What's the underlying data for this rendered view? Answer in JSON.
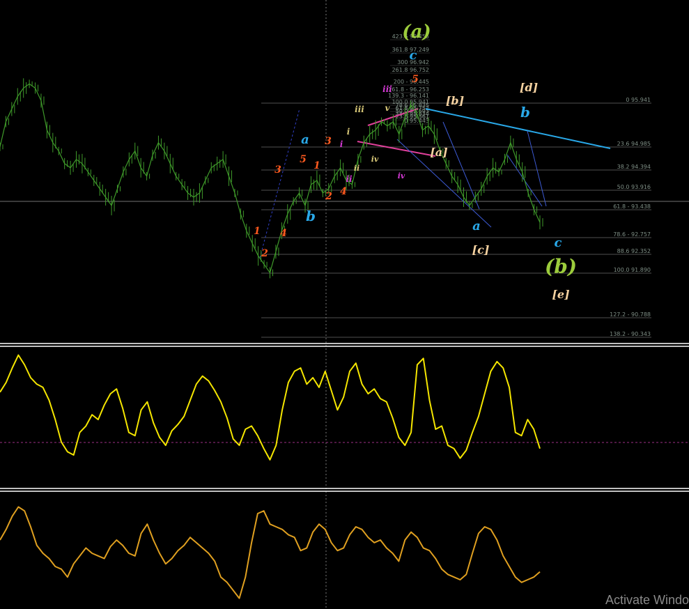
{
  "colors": {
    "background": "#000000",
    "price_line": "#3f9a2a",
    "oscillator_1": "#f5e600",
    "oscillator_2": "#e0a020",
    "fib_line": "#6a6a6a",
    "trend_blue": "#29a8e8",
    "trend_pink": "#e0409a",
    "separator": "#ffffff",
    "zero_line": "#9b2f86"
  },
  "fib_levels": [
    {
      "label": "0 95.941",
      "price": 95.941
    },
    {
      "label": "23.6 94.985",
      "price": 94.985
    },
    {
      "label": "38.2 94.394",
      "price": 94.394
    },
    {
      "label": "50.0 93.916",
      "price": 93.916
    },
    {
      "label": "61.8 - 93.438",
      "price": 93.438
    },
    {
      "label": "78.6 - 92.757",
      "price": 92.757
    },
    {
      "label": "88.6 92.352",
      "price": 92.352
    },
    {
      "label": "100.0 91.890",
      "price": 91.89
    },
    {
      "label": "127.2 - 90.788",
      "price": 90.788
    },
    {
      "label": "138.2 - 90.343",
      "price": 90.343
    }
  ],
  "fib_stack": [
    "423.6 98.455",
    "361.8 97.249",
    "300 96.942",
    "261.8 96.752",
    "200 - 96.445",
    "161.8 - 96.253",
    "139.3 - 96.141",
    "100.0 95.941",
    "78.6 95.835",
    "61.8 95.752",
    "50.0 95.693",
    "38.2 95.634",
    "23.6 95.561",
    "0 95.443"
  ],
  "wave_labels": [
    {
      "text": "(a)",
      "color": "#9ccc3c"
    },
    {
      "text": "c",
      "color": "#29a8e8"
    },
    {
      "text": "5",
      "color": "#ff5a1f"
    },
    {
      "text": "iii",
      "color": "#d63ad6"
    },
    {
      "text": "[b]",
      "color": "#f5d2a0"
    },
    {
      "text": "[d]",
      "color": "#f5d2a0"
    },
    {
      "text": "b",
      "color": "#29a8e8"
    },
    {
      "text": "iii",
      "color": "#d8c878"
    },
    {
      "text": "v",
      "color": "#d8c878"
    },
    {
      "text": "i",
      "color": "#d8c878"
    },
    {
      "text": "a",
      "color": "#29a8e8"
    },
    {
      "text": "3",
      "color": "#ff5a1f"
    },
    {
      "text": "i",
      "color": "#d63ad6"
    },
    {
      "text": "[a]",
      "color": "#f5d2a0"
    },
    {
      "text": "5",
      "color": "#ff5a1f"
    },
    {
      "text": "1",
      "color": "#ff5a1f"
    },
    {
      "text": "3",
      "color": "#ff5a1f"
    },
    {
      "text": "iv",
      "color": "#d8c878"
    },
    {
      "text": "ii",
      "color": "#d8c878"
    },
    {
      "text": "iv",
      "color": "#d63ad6"
    },
    {
      "text": "ii",
      "color": "#d63ad6"
    },
    {
      "text": "4",
      "color": "#ff5a1f"
    },
    {
      "text": "2",
      "color": "#ff5a1f"
    },
    {
      "text": "b",
      "color": "#29a8e8"
    },
    {
      "text": "1",
      "color": "#ff5a1f"
    },
    {
      "text": "4",
      "color": "#ff5a1f"
    },
    {
      "text": "2",
      "color": "#ff5a1f"
    },
    {
      "text": "a",
      "color": "#29a8e8"
    },
    {
      "text": "[c]",
      "color": "#f5d2a0"
    },
    {
      "text": "c",
      "color": "#29a8e8"
    },
    {
      "text": "(b)",
      "color": "#9ccc3c"
    },
    {
      "text": "[e]",
      "color": "#f5d2a0"
    }
  ],
  "chart_data": {
    "type": "line",
    "series": [
      {
        "values": [
          94.9,
          95.5,
          95.8,
          96.1,
          96.3,
          96.4,
          96.3,
          96.0,
          95.3,
          95.0,
          94.8,
          94.5,
          94.4,
          94.6,
          94.5,
          94.3,
          94.1,
          93.9,
          93.7,
          93.5,
          93.9,
          94.3,
          94.6,
          94.8,
          94.4,
          94.2,
          94.7,
          95.0,
          94.8,
          94.5,
          94.2,
          94.0,
          93.8,
          93.7,
          93.8,
          94.1,
          94.4,
          94.5,
          94.6,
          94.2,
          93.8,
          93.3,
          92.9,
          92.6,
          92.3,
          92.1,
          91.9,
          92.4,
          92.9,
          93.3,
          93.6,
          93.8,
          93.5,
          94.0,
          94.1,
          93.8,
          93.9,
          94.2,
          94.4,
          94.1,
          94.0,
          94.6,
          95.0,
          95.2,
          95.3,
          95.5,
          95.4,
          95.5,
          95.2,
          95.6,
          95.9,
          95.7,
          95.3,
          95.4,
          95.2,
          94.8,
          94.5,
          94.2,
          94.0,
          93.7,
          93.5,
          93.7,
          93.9,
          94.2,
          94.4,
          94.3,
          94.6,
          95.0,
          94.6,
          94.3,
          93.8,
          93.4,
          93.1
        ]
      },
      {
        "values": [
          55,
          61,
          70,
          78,
          72,
          64,
          60,
          58,
          50,
          38,
          24,
          18,
          16,
          30,
          34,
          41,
          38,
          47,
          54,
          57,
          45,
          30,
          28,
          44,
          49,
          36,
          27,
          22,
          31,
          35,
          40,
          50,
          60,
          65,
          62,
          56,
          49,
          39,
          26,
          22,
          32,
          34,
          28,
          20,
          13,
          22,
          44,
          61,
          68,
          70,
          60,
          64,
          58,
          68,
          56,
          44,
          52,
          68,
          73,
          60,
          54,
          57,
          51,
          49,
          39,
          27,
          22,
          30,
          72,
          76,
          50,
          32,
          34,
          22,
          20,
          14,
          19,
          30,
          40,
          54,
          68,
          74,
          70,
          58,
          30,
          28,
          38,
          32,
          20
        ]
      },
      {
        "values": [
          50,
          58,
          68,
          75,
          72,
          60,
          46,
          40,
          36,
          30,
          28,
          22,
          32,
          38,
          44,
          40,
          38,
          36,
          45,
          50,
          46,
          40,
          38,
          55,
          62,
          50,
          40,
          32,
          36,
          42,
          46,
          52,
          48,
          44,
          40,
          34,
          22,
          18,
          12,
          6,
          22,
          48,
          70,
          72,
          62,
          60,
          58,
          54,
          52,
          42,
          44,
          56,
          62,
          58,
          48,
          42,
          44,
          54,
          60,
          58,
          52,
          48,
          50,
          44,
          40,
          34,
          50,
          56,
          52,
          44,
          42,
          36,
          28,
          24,
          22,
          20,
          24,
          40,
          55,
          60,
          58,
          50,
          38,
          30,
          22,
          18,
          20,
          22,
          26
        ]
      }
    ]
  },
  "watermark": "Activate Windo"
}
